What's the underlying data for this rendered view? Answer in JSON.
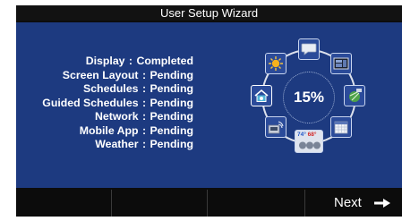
{
  "title": "User Setup Wizard",
  "steps": [
    {
      "label": "Display",
      "status": "Completed"
    },
    {
      "label": "Screen Layout",
      "status": "Pending"
    },
    {
      "label": "Schedules",
      "status": "Pending"
    },
    {
      "label": "Guided Schedules",
      "status": "Pending"
    },
    {
      "label": "Network",
      "status": "Pending"
    },
    {
      "label": "Mobile App",
      "status": "Pending"
    },
    {
      "label": "Weather",
      "status": "Pending"
    }
  ],
  "separator": ":",
  "progress_text": "15%",
  "progress_fraction": 0.15,
  "diagram": {
    "temp_high": "74°",
    "temp_low": "68°",
    "icons": [
      "speech-bubble-icon",
      "screen-layout-icon",
      "network-sat-icon",
      "calendar-icon",
      "thermostat-icon",
      "wifi-device-icon",
      "home-icon",
      "sun-icon"
    ]
  },
  "next_label": "Next",
  "colors": {
    "panel": "#1d3a80",
    "title_bar": "#121212",
    "text": "#ffffff",
    "bottom_bar": "#0c0c0c"
  }
}
